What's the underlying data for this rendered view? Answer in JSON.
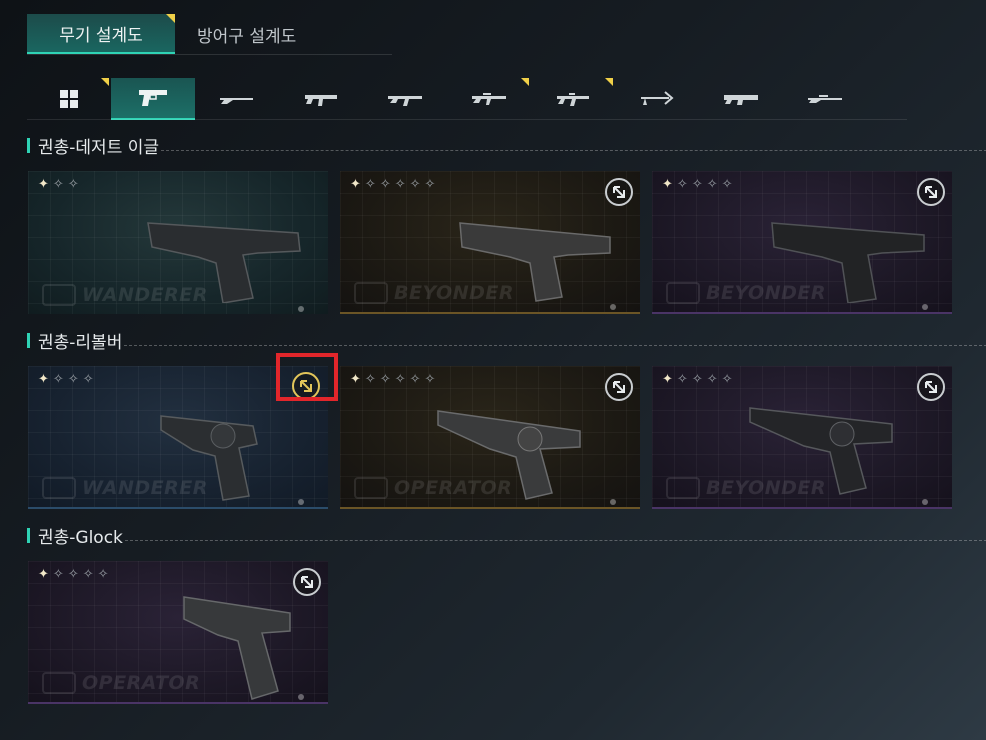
{
  "top_tabs": [
    {
      "label": "무기 설계도",
      "active": true,
      "flag": true
    },
    {
      "label": "방어구 설계도",
      "active": false,
      "flag": false
    }
  ],
  "categories": [
    {
      "icon": "grid-icon",
      "active": false,
      "flag": true
    },
    {
      "icon": "pistol-icon",
      "active": true,
      "flag": false
    },
    {
      "icon": "shotgun-icon",
      "active": false,
      "flag": false
    },
    {
      "icon": "smg-icon",
      "active": false,
      "flag": false
    },
    {
      "icon": "assault-rifle-icon",
      "active": false,
      "flag": false
    },
    {
      "icon": "rifle-icon",
      "active": false,
      "flag": true
    },
    {
      "icon": "carbine-icon",
      "active": false,
      "flag": true
    },
    {
      "icon": "crossbow-icon",
      "active": false,
      "flag": false
    },
    {
      "icon": "machine-gun-icon",
      "active": false,
      "flag": false
    },
    {
      "icon": "sniper-rifle-icon",
      "active": false,
      "flag": false
    }
  ],
  "sections": [
    {
      "title": "권총-데저트 이글",
      "cards": [
        {
          "brand": "WANDERER",
          "stars": 3,
          "theme": "teal",
          "maximize": false
        },
        {
          "brand": "BEYONDER",
          "stars": 6,
          "theme": "gold",
          "maximize": true
        },
        {
          "brand": "BEYONDER",
          "stars": 5,
          "theme": "purple",
          "maximize": true
        }
      ]
    },
    {
      "title": "권총-리볼버",
      "cards": [
        {
          "brand": "WANDERER",
          "stars": 4,
          "theme": "blue",
          "maximize": true,
          "highlighted": true
        },
        {
          "brand": "OPERATOR",
          "stars": 6,
          "theme": "gold",
          "maximize": true
        },
        {
          "brand": "BEYONDER",
          "stars": 5,
          "theme": "purple",
          "maximize": true
        }
      ]
    },
    {
      "title": "권총-Glock",
      "cards": [
        {
          "brand": "OPERATOR",
          "stars": 5,
          "theme": "purple",
          "maximize": true
        }
      ]
    }
  ],
  "colors": {
    "accent": "#2fd3b5",
    "flag": "#f0d048",
    "highlight": "#e2262b",
    "maximize_gold": "#e2c55a"
  }
}
